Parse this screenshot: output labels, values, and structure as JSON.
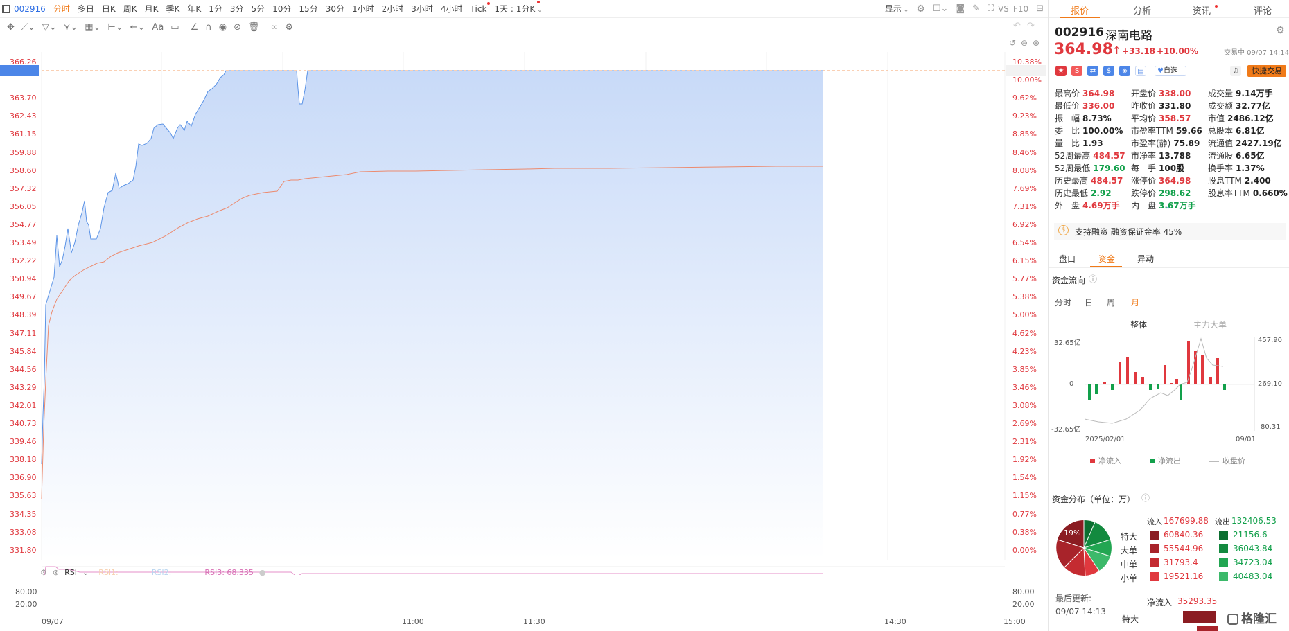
{
  "topbar": {
    "symbol": "002916",
    "timeframes": [
      "分时",
      "多日",
      "日K",
      "周K",
      "月K",
      "季K",
      "年K",
      "1分",
      "3分",
      "5分",
      "10分",
      "15分",
      "30分",
      "1小时",
      "2小时",
      "3小时",
      "4小时",
      "Tick",
      "1天 : 1分K"
    ],
    "active_index": 0,
    "display_label": "显示",
    "vs_label": "VS",
    "f10_label": "F10"
  },
  "chart": {
    "left_axis": [
      "366.26",
      "364.98",
      "363.70",
      "362.43",
      "361.15",
      "359.88",
      "358.60",
      "357.32",
      "356.05",
      "354.77",
      "353.49",
      "352.22",
      "350.94",
      "349.67",
      "348.39",
      "347.11",
      "345.84",
      "344.56",
      "343.29",
      "342.01",
      "340.73",
      "339.46",
      "338.18",
      "336.90",
      "335.63",
      "334.35",
      "333.08",
      "331.80"
    ],
    "right_axis": [
      "10.38%",
      "10.00%",
      "9.62%",
      "9.23%",
      "8.85%",
      "8.46%",
      "8.08%",
      "7.69%",
      "7.31%",
      "6.92%",
      "6.54%",
      "6.15%",
      "5.77%",
      "5.38%",
      "5.00%",
      "4.62%",
      "4.23%",
      "3.85%",
      "3.46%",
      "3.08%",
      "2.69%",
      "2.31%",
      "1.92%",
      "1.54%",
      "1.15%",
      "0.77%",
      "0.38%",
      "0.00%"
    ],
    "x_labels": [
      "09/07",
      "11:00",
      "11:30",
      "14:30",
      "15:00"
    ],
    "highlight_price": "364.98",
    "highlight_pct": "10.00%",
    "rsi": {
      "label": "RSI",
      "rsi1": "RSI1:",
      "rsi2": "RSI2:",
      "rsi3": "RSI3: 68.335",
      "levels": [
        "80.00",
        "20.00"
      ]
    }
  },
  "quote": {
    "tabs": [
      "报价",
      "分析",
      "资讯",
      "评论"
    ],
    "code": "002916",
    "name": "深南电路",
    "price": "364.98",
    "change": "+33.18",
    "change_pct": "+10.00%",
    "status": "交易中 09/07 14:14",
    "watch_label": "自选",
    "fast_trade_label": "快捷交易",
    "stats": [
      [
        "最高价",
        "364.98",
        "r"
      ],
      [
        "开盘价",
        "338.00",
        "r"
      ],
      [
        "成交量",
        "9.14万手",
        "k"
      ],
      [
        "最低价",
        "336.00",
        "r"
      ],
      [
        "昨收价",
        "331.80",
        "k"
      ],
      [
        "成交额",
        "32.77亿",
        "k"
      ],
      [
        "振　幅",
        "8.73%",
        "k"
      ],
      [
        "平均价",
        "358.57",
        "r"
      ],
      [
        "市值",
        "2486.12亿",
        "k"
      ],
      [
        "委　比",
        "100.00%",
        "k"
      ],
      [
        "市盈率TTM",
        "59.66",
        "k"
      ],
      [
        "总股本",
        "6.81亿",
        "k"
      ],
      [
        "量　比",
        "1.93",
        "k"
      ],
      [
        "市盈率(静)",
        "75.89",
        "k"
      ],
      [
        "流通值",
        "2427.19亿",
        "k"
      ],
      [
        "52周最高",
        "484.57",
        "r"
      ],
      [
        "市净率",
        "13.788",
        "k"
      ],
      [
        "流通股",
        "6.65亿",
        "k"
      ],
      [
        "52周最低",
        "179.60",
        "g"
      ],
      [
        "每　手",
        "100股",
        "k"
      ],
      [
        "换手率",
        "1.37%",
        "k"
      ],
      [
        "历史最高",
        "484.57",
        "r"
      ],
      [
        "涨停价",
        "364.98",
        "r"
      ],
      [
        "股息TTM",
        "2.400",
        "k"
      ],
      [
        "历史最低",
        "2.92",
        "g"
      ],
      [
        "跌停价",
        "298.62",
        "g"
      ],
      [
        "股息率TTM",
        "0.660%",
        "k"
      ],
      [
        "外　盘",
        "4.69万手",
        "r"
      ],
      [
        "内　盘",
        "3.67万手",
        "g"
      ],
      [
        "",
        ""
      ]
    ],
    "margin_notice": "支持融资 融资保证金率 45%"
  },
  "capital": {
    "tabs": [
      "盘口",
      "资金",
      "异动"
    ],
    "flow_title": "资金流向",
    "periods": [
      "分时",
      "日",
      "周",
      "月"
    ],
    "subtabs": [
      "整体",
      "主力大单"
    ],
    "y_left": [
      "32.65亿",
      "0",
      "-32.65亿"
    ],
    "y_right": [
      "457.90",
      "269.10",
      "80.31"
    ],
    "x_labels": [
      "2025/02/01",
      "09/01"
    ],
    "legend": [
      "净流入",
      "净流出",
      "收盘价"
    ],
    "dist_title": "资金分布（单位：万）",
    "pie_label": "19%",
    "inflow_label": "流入",
    "inflow_total": "167699.88",
    "outflow_label": "流出",
    "outflow_total": "132406.53",
    "rows": [
      {
        "name": "特大",
        "in": "60840.36",
        "out": "21156.6"
      },
      {
        "name": "大单",
        "in": "55544.96",
        "out": "36043.84"
      },
      {
        "name": "中单",
        "in": "31793.4",
        "out": "34723.04"
      },
      {
        "name": "小单",
        "in": "19521.16",
        "out": "40483.04"
      }
    ],
    "update_label": "最后更新:",
    "update_time": "09/07 14:13",
    "net_label": "净流入",
    "net_value": "35293.35",
    "net_row": "特大",
    "watermark": "格隆汇"
  },
  "colors": {
    "up": "#e0383e",
    "down": "#12a04b",
    "accent": "#f07a19",
    "blue": "#2f6fe4"
  }
}
